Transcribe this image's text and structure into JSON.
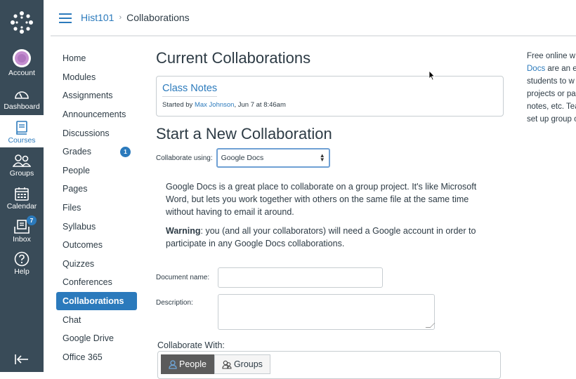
{
  "global_nav": {
    "items": [
      {
        "label": "Account",
        "icon": "account-avatar-icon"
      },
      {
        "label": "Dashboard",
        "icon": "dashboard-icon"
      },
      {
        "label": "Courses",
        "icon": "courses-icon",
        "active": true
      },
      {
        "label": "Groups",
        "icon": "groups-icon"
      },
      {
        "label": "Calendar",
        "icon": "calendar-icon"
      },
      {
        "label": "Inbox",
        "icon": "inbox-icon",
        "badge": "7"
      },
      {
        "label": "Help",
        "icon": "help-icon"
      }
    ]
  },
  "header": {
    "course": "Hist101",
    "current": "Collaborations"
  },
  "course_nav": {
    "items": [
      {
        "label": "Home"
      },
      {
        "label": "Modules"
      },
      {
        "label": "Assignments"
      },
      {
        "label": "Announcements"
      },
      {
        "label": "Discussions"
      },
      {
        "label": "Grades",
        "badge": "1"
      },
      {
        "label": "People"
      },
      {
        "label": "Pages"
      },
      {
        "label": "Files"
      },
      {
        "label": "Syllabus"
      },
      {
        "label": "Outcomes"
      },
      {
        "label": "Quizzes"
      },
      {
        "label": "Conferences"
      },
      {
        "label": "Collaborations",
        "active": true
      },
      {
        "label": "Chat"
      },
      {
        "label": "Google Drive"
      },
      {
        "label": "Office 365"
      }
    ]
  },
  "main": {
    "current_heading": "Current Collaborations",
    "collaboration": {
      "title": "Class Notes",
      "started_by_prefix": "Started by ",
      "author": "Max Johnson",
      "date_suffix": ", Jun 7 at 8:46am"
    },
    "new_heading": "Start a New Collaboration",
    "collaborate_using_label": "Collaborate using:",
    "collaborate_using_value": "Google Docs",
    "description_p1": "Google Docs is a great place to collaborate on a group project. It's like Microsoft Word, but lets you work together with others on the same file at the same time without having to email it around.",
    "warning_label": "Warning",
    "warning_text": ": you (and all your collaborators) will need a Google account in order to participate in any Google Docs collaborations.",
    "document_name_label": "Document name:",
    "document_name_value": "",
    "description_label": "Description:",
    "description_value": "",
    "collaborate_with_label": "Collaborate With:",
    "tabs": [
      {
        "label": "People",
        "active": true
      },
      {
        "label": "Groups",
        "active": false
      }
    ]
  },
  "aside": {
    "line1": "Free online w",
    "link": "Docs",
    "line2_rest": " are an ex",
    "line3": "students to w",
    "line4": "projects or pa",
    "line5": "notes, etc. Tea",
    "line6": "set up group c"
  }
}
